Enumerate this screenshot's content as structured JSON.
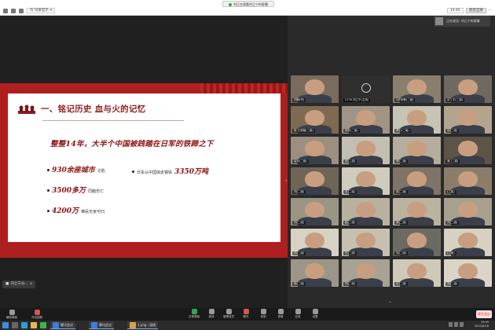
{
  "topbar": {
    "view_selector": "均 均屏显示",
    "meeting_title": "刘正在观看刘之宁的屏幕",
    "time": "10:45",
    "exit_fullscreen": "退出全屏",
    "overflow_label": "···"
  },
  "panel": {
    "view_label": "正在说话: 刘之宁的屏幕"
  },
  "slide": {
    "title": "一、铭记历史 血与火的记忆",
    "quote": "整整14年，大半个中国被践踏在日军的铁蹄之下",
    "bullets": [
      {
        "big": "930余座城市",
        "small": "沦陷"
      },
      {
        "big": "3500多万",
        "small": "同胞伤亡"
      },
      {
        "big": "4200万",
        "small": "难民无家可归"
      }
    ],
    "side_bullet": {
      "small": "日军从中国掠走钢铁",
      "big": "3350万吨"
    }
  },
  "status_tag": "刘之宁分...",
  "participants": [
    {
      "name": "刘畅(学)",
      "style": "person",
      "bg": "#7b6b5c"
    },
    {
      "name": "2776 刘之宁(主持)",
      "style": "mic"
    },
    {
      "name": "2岁张雅(二组)",
      "style": "person",
      "bg": "#8a7f6e"
    },
    {
      "name": "2门 王(二组)",
      "style": "person",
      "bg": "#6e6a62"
    },
    {
      "name": "张 王语馨(二组)",
      "style": "person",
      "bg": "#7d6a50"
    },
    {
      "name": "张彤(二组)",
      "style": "person",
      "bg": "#a09585"
    },
    {
      "name": "李心(二组)",
      "style": "person",
      "bg": "#c7c3b5"
    },
    {
      "name": "刘(二组)",
      "style": "person",
      "bg": "#b3a48f"
    },
    {
      "name": "吕可(二组)",
      "style": "person",
      "bg": "#9c8f80"
    },
    {
      "name": "孙(二组)",
      "style": "person",
      "bg": "#c2beb2"
    },
    {
      "name": "李(二组)",
      "style": "person",
      "bg": "#b5ad9d"
    },
    {
      "name": "吴 (二组)",
      "style": "person",
      "bg": "#5d5448"
    },
    {
      "name": "刘(二组)",
      "style": "person",
      "bg": "#6e6556"
    },
    {
      "name": "王(二组)",
      "style": "person",
      "bg": "#cfcbbd"
    },
    {
      "name": "张(二组)",
      "style": "person",
      "bg": "#7f7467"
    },
    {
      "name": "(二组)",
      "style": "person",
      "bg": "#8b7d6a"
    },
    {
      "name": "刘(二组)",
      "style": "person",
      "bg": "#9b9584"
    },
    {
      "name": "赵(二组)",
      "style": "person",
      "bg": "#b8b1a0"
    },
    {
      "name": "宋(二组)",
      "style": "person",
      "bg": "#bab39f"
    },
    {
      "name": "刘(二组)",
      "style": "person",
      "bg": "#a7a08f"
    },
    {
      "name": "刘(二组)",
      "style": "person",
      "bg": "#d7d2c4"
    },
    {
      "name": "王(二组)",
      "style": "person",
      "bg": "#c6c0b0"
    },
    {
      "name": "刘(二组)",
      "style": "person",
      "bg": "#6b6b62"
    },
    {
      "name": "(二组)",
      "style": "person",
      "bg": "#d6d1c3"
    },
    {
      "name": "林(二组)",
      "style": "person",
      "bg": "#9c9688"
    },
    {
      "name": "刘(二组)",
      "style": "person",
      "bg": "#a8a294"
    },
    {
      "name": "王(二组)",
      "style": "person",
      "bg": "#cfc9ba"
    },
    {
      "name": "刘(二组)",
      "style": "person",
      "bg": "#dad5c8"
    }
  ],
  "controls": {
    "left": [
      "解除静音",
      "开启视频"
    ],
    "center": [
      "共享屏幕",
      "邀请",
      "管理成员",
      "聊天",
      "录制",
      "表情",
      "应用",
      "设置"
    ],
    "leave": "离开会议"
  },
  "taskbar": {
    "apps": [
      "腾讯会议",
      "腾讯会议",
      "1.png - 画图"
    ],
    "time": "19:45",
    "date": "2022/8/18"
  },
  "colors": {
    "slide_red": "#b01f1f",
    "title_red": "#8e1b1b",
    "accent_green": "#2fa84f"
  }
}
